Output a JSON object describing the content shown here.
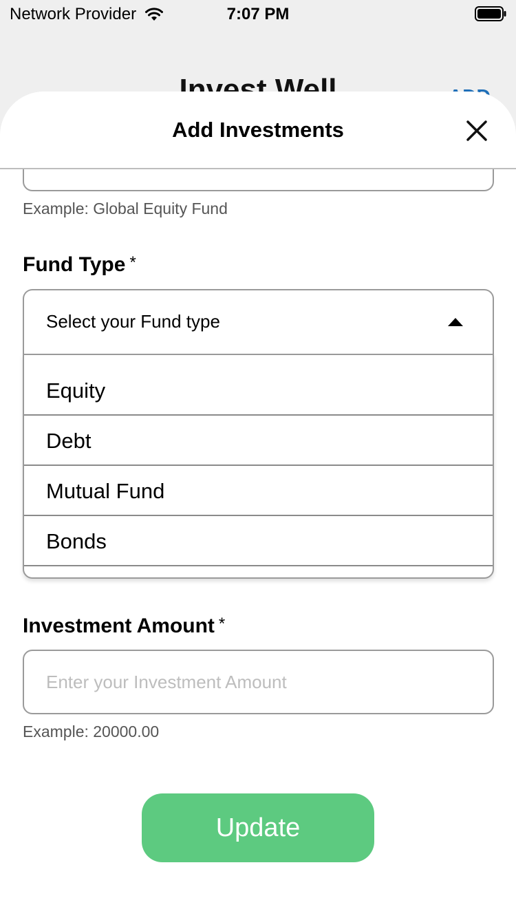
{
  "status_bar": {
    "carrier": "Network Provider",
    "time": "7:07 PM",
    "icons": [
      "wifi-icon",
      "battery-icon"
    ]
  },
  "background": {
    "app_title": "Invest Well",
    "header_link": "ADD"
  },
  "sheet": {
    "title": "Add Investments",
    "close_icon": "close-icon"
  },
  "form": {
    "fund_name_hint": "Example: Global Equity Fund",
    "fund_type": {
      "label": "Fund Type",
      "required_mark": "*",
      "selected_value": "Select your Fund type",
      "caret_icon": "caret-up-icon",
      "options": [
        "Equity",
        "Debt",
        "Mutual Fund",
        "Bonds"
      ]
    },
    "investment_amount": {
      "label": "Investment Amount",
      "required_mark": "*",
      "placeholder": "Enter your Investment Amount",
      "hint": "Example: 20000.00"
    },
    "update_button": "Update"
  },
  "colors": {
    "accent_green": "#5dca80",
    "link_blue": "#1f6fb8",
    "border_gray": "#9a9a9a",
    "placeholder_gray": "#bdbdbd"
  }
}
